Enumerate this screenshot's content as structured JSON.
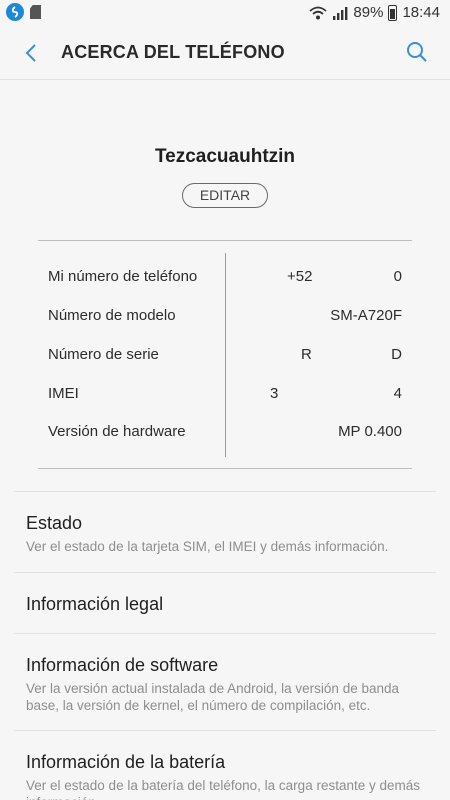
{
  "status_bar": {
    "wifi_icon": "wifi-icon",
    "signal_icon": "signal-icon",
    "battery_percent": "89%",
    "time": "18:44"
  },
  "header": {
    "title": "ACERCA DEL TELÉFONO",
    "back_icon": "back-arrow-icon",
    "search_icon": "search-icon"
  },
  "profile": {
    "device_name": "Tezcacuauhtzin",
    "edit_label": "EDITAR"
  },
  "info": {
    "phone_number": {
      "label": "Mi número de teléfono",
      "value_left": "+52",
      "value_right": "0"
    },
    "model_number": {
      "label": "Número de modelo",
      "value": "SM-A720F"
    },
    "serial_number": {
      "label": "Número de serie",
      "value_left": "R",
      "value_right": "D"
    },
    "imei": {
      "label": "IMEI",
      "value_left": "3",
      "value_right": "4"
    },
    "hardware_version": {
      "label": "Versión de hardware",
      "value": "MP 0.400"
    }
  },
  "menu": {
    "status": {
      "title": "Estado",
      "subtitle": "Ver el estado de la tarjeta SIM, el IMEI y demás información."
    },
    "legal": {
      "title": "Información legal"
    },
    "software": {
      "title": "Información de software",
      "subtitle": "Ver la versión actual instalada de Android, la versión de banda base, la versión de kernel, el número de compilación, etc."
    },
    "battery": {
      "title": "Información de la batería",
      "subtitle": "Ver el estado de la batería del teléfono, la carga restante y demás información."
    }
  },
  "colors": {
    "accent": "#3a8fd8",
    "background": "#f6f6f6"
  }
}
